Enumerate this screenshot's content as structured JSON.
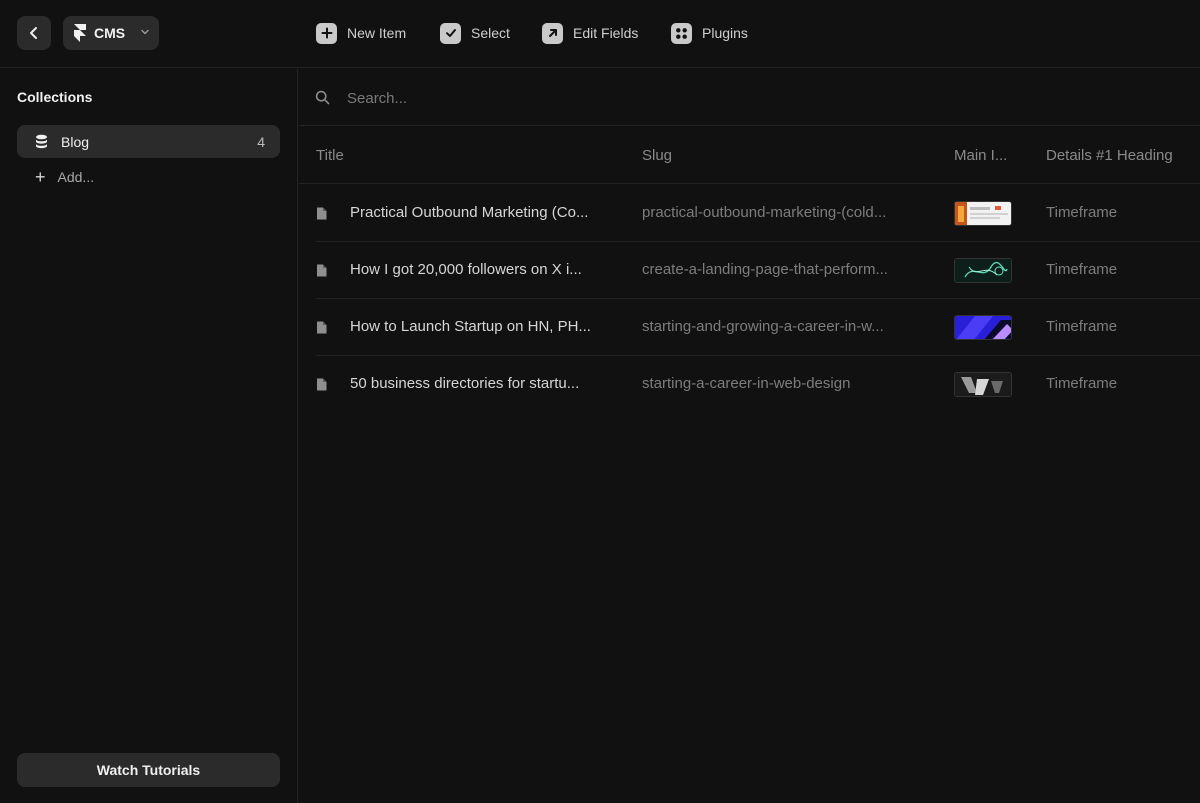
{
  "app": {
    "name": "CMS"
  },
  "toolbar": {
    "new_item": "New Item",
    "select": "Select",
    "edit_fields": "Edit Fields",
    "plugins": "Plugins"
  },
  "sidebar": {
    "title": "Collections",
    "collections": [
      {
        "name": "Blog",
        "count": "4"
      }
    ],
    "add_label": "Add...",
    "tutorials_label": "Watch Tutorials"
  },
  "search": {
    "placeholder": "Search..."
  },
  "table": {
    "columns": [
      "Title",
      "Slug",
      "Main I...",
      "Details #1 Heading"
    ],
    "rows": [
      {
        "title": "Practical Outbound Marketing (Co...",
        "slug": "practical-outbound-marketing-(cold...",
        "detail": "Timeframe"
      },
      {
        "title": "How I got 20,000 followers on X i...",
        "slug": "create-a-landing-page-that-perform...",
        "detail": "Timeframe"
      },
      {
        "title": "How to Launch Startup on HN, PH...",
        "slug": "starting-and-growing-a-career-in-w...",
        "detail": "Timeframe"
      },
      {
        "title": "50 business directories for startu...",
        "slug": "starting-a-career-in-web-design",
        "detail": "Timeframe"
      }
    ]
  },
  "colors": {
    "background": "#111111",
    "panel": "#2b2b2b",
    "border": "#232323",
    "text_primary": "#e8e8e8",
    "text_muted": "#7d7d7d"
  },
  "icons": {
    "back": "chevron-left-icon",
    "logo": "framer-logo-icon",
    "new_item": "plus-square-icon",
    "select": "check-square-icon",
    "edit_fields": "arrow-up-right-square-icon",
    "plugins": "plugins-grid-icon",
    "collection": "database-icon",
    "search": "search-icon",
    "row": "document-icon"
  }
}
